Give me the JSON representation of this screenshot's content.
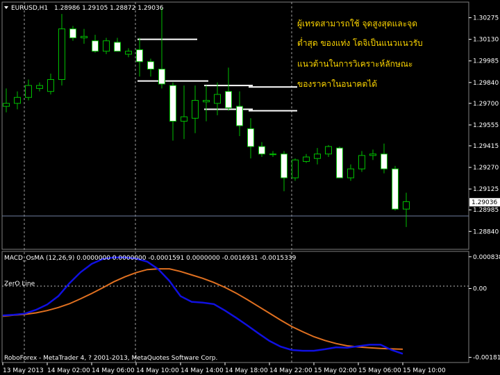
{
  "header": {
    "symbol": "EURUSD,H1",
    "ohlc": "1.28986 1.29105 1.28872 1.29036"
  },
  "annotation": {
    "line1": "ผู้เทรดสามารถใช้ จุดสูงสุดและจุด",
    "line2": "ต่ำสุด ของแท่ง โดจิเป็นแนวแนวรับ",
    "line3": "แนวต้านในการวิเคราะห์ลักษณะ",
    "line4": "ของราคาในอนาคตได้"
  },
  "indicator": {
    "title": "MACD_OsMA (12,26,9) 0.0000000 0.0000000 -0.0001591 0.0000000 -0.0016931 -0.0015339",
    "zero_label": "ZerO Line"
  },
  "copyright": "RoboForex - MetaTrader 4, ? 2001-2013, MetaQuotes Software Corp.",
  "colors": {
    "bull": "#00c000",
    "bear_fill": "#ffffff",
    "macd": "#1010e0",
    "signal": "#e07020",
    "level": "#ffffff"
  },
  "chart_data": {
    "type": "candlestick",
    "price_axis": {
      "min": 1.2872,
      "max": 1.3038,
      "ticks": [
        "1.30275",
        "1.30130",
        "1.29985",
        "1.29840",
        "1.29700",
        "1.29555",
        "1.29415",
        "1.29270",
        "1.29125",
        "1.28985",
        "1.28840"
      ],
      "current": "1.29036"
    },
    "time_labels": [
      "13 May 2013",
      "14 May 02:00",
      "14 May 06:00",
      "14 May 10:00",
      "14 May 14:00",
      "14 May 18:00",
      "14 May 22:00",
      "15 May 02:00",
      "15 May 06:00",
      "15 May 10:00"
    ],
    "candles": [
      {
        "o": 1.2968,
        "h": 1.298,
        "l": 1.2964,
        "c": 1.297
      },
      {
        "o": 1.297,
        "h": 1.2978,
        "l": 1.2966,
        "c": 1.2974
      },
      {
        "o": 1.2974,
        "h": 1.2986,
        "l": 1.2972,
        "c": 1.2982
      },
      {
        "o": 1.298,
        "h": 1.2984,
        "l": 1.2978,
        "c": 1.2982
      },
      {
        "o": 1.2978,
        "h": 1.299,
        "l": 1.2976,
        "c": 1.2986
      },
      {
        "o": 1.2986,
        "h": 1.303,
        "l": 1.2982,
        "c": 1.302
      },
      {
        "o": 1.302,
        "h": 1.3022,
        "l": 1.3012,
        "c": 1.3014
      },
      {
        "o": 1.3014,
        "h": 1.302,
        "l": 1.301,
        "c": 1.3015
      },
      {
        "o": 1.3012,
        "h": 1.3016,
        "l": 1.3004,
        "c": 1.3005
      },
      {
        "o": 1.3005,
        "h": 1.3014,
        "l": 1.3003,
        "c": 1.3012
      },
      {
        "o": 1.3011,
        "h": 1.3014,
        "l": 1.3005,
        "c": 1.3005
      },
      {
        "o": 1.3003,
        "h": 1.3007,
        "l": 1.3001,
        "c": 1.3005
      },
      {
        "o": 1.3006,
        "h": 1.3014,
        "l": 1.2988,
        "c": 1.2998
      },
      {
        "o": 1.2998,
        "h": 1.3,
        "l": 1.2988,
        "c": 1.2993
      },
      {
        "o": 1.2993,
        "h": 1.3034,
        "l": 1.298,
        "c": 1.2983
      },
      {
        "o": 1.2982,
        "h": 1.2984,
        "l": 1.2945,
        "c": 1.2958
      },
      {
        "o": 1.2958,
        "h": 1.2982,
        "l": 1.2946,
        "c": 1.2961
      },
      {
        "o": 1.296,
        "h": 1.2982,
        "l": 1.295,
        "c": 1.2972
      },
      {
        "o": 1.2971,
        "h": 1.2982,
        "l": 1.2958,
        "c": 1.2972
      },
      {
        "o": 1.297,
        "h": 1.2984,
        "l": 1.2962,
        "c": 1.2976
      },
      {
        "o": 1.2978,
        "h": 1.2994,
        "l": 1.2965,
        "c": 1.2967
      },
      {
        "o": 1.2968,
        "h": 1.2978,
        "l": 1.2948,
        "c": 1.2955
      },
      {
        "o": 1.2953,
        "h": 1.296,
        "l": 1.2933,
        "c": 1.2941
      },
      {
        "o": 1.2941,
        "h": 1.2944,
        "l": 1.2934,
        "c": 1.2936
      },
      {
        "o": 1.2936,
        "h": 1.2938,
        "l": 1.2934,
        "c": 1.2936
      },
      {
        "o": 1.2936,
        "h": 1.2938,
        "l": 1.2911,
        "c": 1.292
      },
      {
        "o": 1.292,
        "h": 1.2933,
        "l": 1.2918,
        "c": 1.2932
      },
      {
        "o": 1.2931,
        "h": 1.2936,
        "l": 1.293,
        "c": 1.2934
      },
      {
        "o": 1.2933,
        "h": 1.294,
        "l": 1.2929,
        "c": 1.2936
      },
      {
        "o": 1.2936,
        "h": 1.2942,
        "l": 1.2934,
        "c": 1.2941
      },
      {
        "o": 1.294,
        "h": 1.2941,
        "l": 1.292,
        "c": 1.292
      },
      {
        "o": 1.292,
        "h": 1.2929,
        "l": 1.2918,
        "c": 1.2926
      },
      {
        "o": 1.2926,
        "h": 1.2938,
        "l": 1.2924,
        "c": 1.2935
      },
      {
        "o": 1.2935,
        "h": 1.2939,
        "l": 1.2932,
        "c": 1.2936
      },
      {
        "o": 1.2936,
        "h": 1.2943,
        "l": 1.2923,
        "c": 1.2926
      },
      {
        "o": 1.2926,
        "h": 1.2928,
        "l": 1.2898,
        "c": 1.2899
      },
      {
        "o": 1.2899,
        "h": 1.291,
        "l": 1.2887,
        "c": 1.2904
      }
    ],
    "levels": [
      {
        "price": 1.3013,
        "from": 12,
        "to": 17
      },
      {
        "price": 1.2985,
        "from": 12,
        "to": 18
      },
      {
        "price": 1.2982,
        "from": 18,
        "to": 22
      },
      {
        "price": 1.2981,
        "from": 22,
        "to": 26
      },
      {
        "price": 1.2966,
        "from": 18,
        "to": 22
      },
      {
        "price": 1.2965,
        "from": 22,
        "to": 26
      }
    ],
    "macd_axis": {
      "min": -0.00195,
      "max": 0.00098,
      "ticks": [
        "0.000838",
        "0.00",
        "-0.001813"
      ]
    },
    "macd": [
      -0.00071,
      -0.00069,
      -0.00066,
      -0.00056,
      -0.00042,
      -0.0002,
      0.00014,
      0.00043,
      0.00065,
      0.00078,
      0.00082,
      0.00082,
      0.00079,
      0.00071,
      0.00051,
      0.0002,
      -0.0002,
      -0.00035,
      -0.00037,
      -0.00041,
      -0.00058,
      -0.00077,
      -0.00097,
      -0.00118,
      -0.00138,
      -0.00153,
      -0.00162,
      -0.00164,
      -0.00164,
      -0.0016,
      -0.00155,
      -0.00156,
      -0.00152,
      -0.00148,
      -0.00148,
      -0.00162,
      -0.00172
    ],
    "signal": [
      -0.00073,
      -0.0007,
      -0.00068,
      -0.00064,
      -0.00058,
      -0.0005,
      -0.0004,
      -0.00027,
      -0.00013,
      2e-05,
      0.00018,
      0.00031,
      0.00042,
      0.0005,
      0.00052,
      0.00052,
      0.00045,
      0.00036,
      0.00027,
      0.00016,
      3e-05,
      -0.00012,
      -0.00029,
      -0.00047,
      -0.00065,
      -0.00083,
      -0.001,
      -0.00114,
      -0.00127,
      -0.00137,
      -0.00145,
      -0.00151,
      -0.00154,
      -0.00156,
      -0.00158,
      -0.00159,
      -0.0016
    ]
  }
}
